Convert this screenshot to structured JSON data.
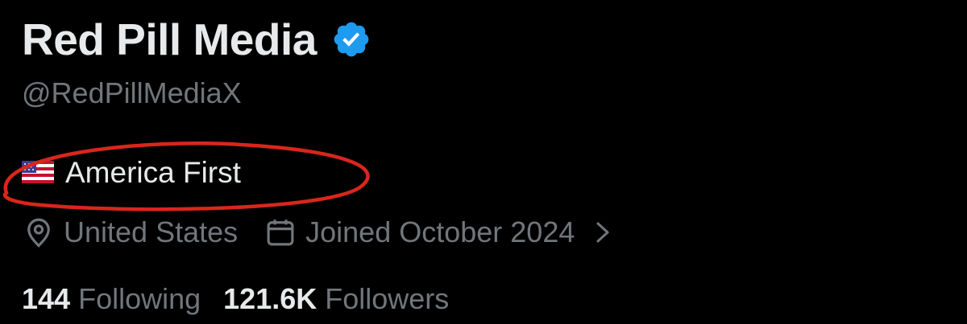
{
  "profile": {
    "display_name": "Red Pill Media",
    "handle": "@RedPillMediaX",
    "bio": "America First",
    "location": "United States",
    "joined": "Joined October 2024",
    "following_count": "144",
    "following_label": "Following",
    "followers_count": "121.6K",
    "followers_label": "Followers"
  },
  "icons": {
    "verified": "verified-badge-icon",
    "flag": "us-flag-emoji",
    "location": "location-pin-icon",
    "calendar": "calendar-icon",
    "chevron": "chevron-right-icon"
  },
  "colors": {
    "background": "#000000",
    "primary_text": "#e7e9ea",
    "secondary_text": "#71767b",
    "verified_blue": "#1d9bf0",
    "annotation_red": "#d9261c"
  }
}
